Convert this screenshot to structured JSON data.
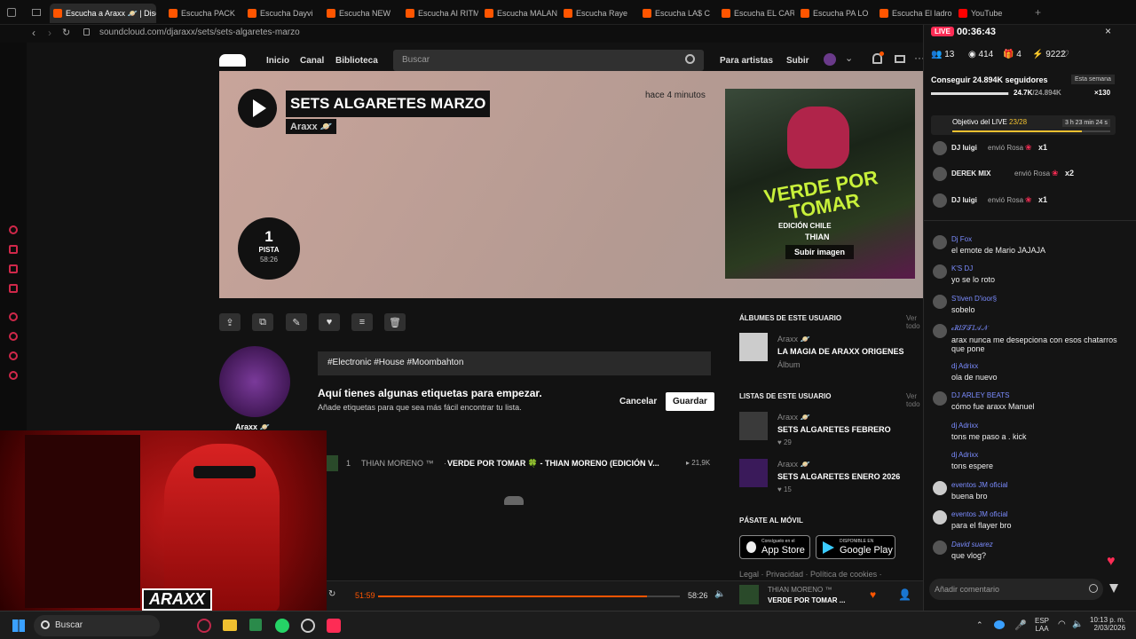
{
  "browser": {
    "tabs": [
      {
        "label": "Escucha a Araxx 🪐 | Disco"
      },
      {
        "label": "Escucha PACK"
      },
      {
        "label": "Escucha Dayvi"
      },
      {
        "label": "Escucha NEW"
      },
      {
        "label": "Escucha AI RITM"
      },
      {
        "label": "Escucha MALAN"
      },
      {
        "label": "Escucha Raye"
      },
      {
        "label": "Escucha LA$ C"
      },
      {
        "label": "Escucha EL CAR"
      },
      {
        "label": "Escucha PA LO"
      },
      {
        "label": "Escucha El ladro"
      },
      {
        "label": "YouTube"
      }
    ],
    "url": "soundcloud.com/djaraxx/sets/sets-algaretes-marzo"
  },
  "sc": {
    "nav": {
      "home": "Inicio",
      "feed": "Canal",
      "library": "Biblioteca",
      "search_placeholder": "Buscar",
      "artists": "Para artistas",
      "upload": "Subir"
    },
    "hero": {
      "title": "SETS ALGARETES MARZO",
      "artist": "Araxx 🪐",
      "posted": "hace 4 minutos",
      "tracks_count": "1",
      "tracks_label": "PISTA",
      "duration": "58:26",
      "upload_image": "Subir imagen",
      "cover_title": "VERDE POR TOMAR",
      "cover_sub": "EDICIÓN CHILE",
      "cover_artist": "THIAN"
    },
    "profile": {
      "name": "Araxx 🪐"
    },
    "tags": {
      "chips": "#Electronic  #House  #Moombahton",
      "heading": "Aquí tienes algunas etiquetas para empezar.",
      "subtitle": "Añade etiquetas para que sea más fácil encontrar tu lista.",
      "cancel": "Cancelar",
      "save": "Guardar"
    },
    "track": {
      "num": "1",
      "artist": "THIAN MORENO ™",
      "title": "VERDE POR TOMAR 🍀 - THIAN MORENO (EDICIÓN V...",
      "plays": "21,9K"
    },
    "sidebar": {
      "albums_heading": "ÁLBUMES DE ESTE USUARIO",
      "view_all": "Ver todo",
      "album": {
        "artist": "Araxx 🪐",
        "title": "LA MAGIA DE ARAXX ORIGENES",
        "type": "Álbum"
      },
      "lists_heading": "LISTAS DE ESTE USUARIO",
      "lists": [
        {
          "artist": "Araxx 🪐",
          "title": "SETS ALGARETES FEBRERO",
          "likes": "29"
        },
        {
          "artist": "Araxx 🪐",
          "title": "SETS ALGARETES ENERO 2026",
          "likes": "15"
        }
      ],
      "mobile_heading": "PÁSATE AL MÓVIL",
      "appstore_small": "Consíguelo en el",
      "appstore": "App Store",
      "play_small": "DISPONIBLE EN",
      "play": "Google Play",
      "footer": "Legal · Privacidad · Política de cookies ·"
    },
    "player": {
      "elapsed": "51:59",
      "total": "58:26",
      "progress": 0.89,
      "artist": "THIAN MORENO ™",
      "title": "VERDE POR TOMAR ..."
    }
  },
  "live": {
    "badge": "LIVE",
    "timer": "00:36:43",
    "stats": [
      "13",
      "414",
      "4",
      "9222"
    ],
    "goal_text": "Conseguir 24.894K seguidores",
    "goal_tag": "Esta semana",
    "goal_value": "24.7K",
    "goal_total": "/24.894K",
    "goal_progress": 0.99,
    "goal_multiplier": "×130",
    "objective": "Objetivo del LIVE",
    "objective_count": "23/28",
    "objective_time": "3 h 23 min 24 s",
    "gifts": [
      {
        "user": "DJ luigi",
        "text": "envió Rosa",
        "count": "x1"
      },
      {
        "user": "DEREK MIX",
        "text": "envió Rosa",
        "count": "x2"
      },
      {
        "user": "DJ luigi",
        "text": "envió Rosa",
        "count": "x1"
      }
    ],
    "chat": [
      {
        "user": "Dj Fox",
        "msg": "el emote de Mario JAJAJA"
      },
      {
        "user": "K'S DJ",
        "msg": "yo se lo roto"
      },
      {
        "user": "S'tiven D'ioor§",
        "msg": "sobelo"
      },
      {
        "user": "𝒸𝑅𝐼𝒮𝒯𝐼𝒜𝒩",
        "msg": "arax nunca me desepciona con esos chatarros que pone"
      },
      {
        "user": "dj Adrixx",
        "msg": "ola de nuevo"
      },
      {
        "user": "DJ ARLEY BEATS",
        "msg": "cómo fue araxx Manuel"
      },
      {
        "user": "dj Adrixx",
        "msg": "tons me paso a . kick"
      },
      {
        "user": "dj Adrixx",
        "msg": "tons espere"
      },
      {
        "user": "eventos JM oficial",
        "msg": "buena bro"
      },
      {
        "user": "eventos JM oficial",
        "msg": "para el flayer bro"
      },
      {
        "user": "David suarez",
        "msg": "que vlog?"
      }
    ],
    "comment_placeholder": "Añadir comentario"
  },
  "taskbar": {
    "search": "Buscar",
    "lang1": "ESP",
    "lang2": "LAA",
    "time": "10:13 p. m.",
    "date": "2/03/2026"
  },
  "cam": {
    "logo": "ARAXX"
  },
  "colors": {
    "accent": "#ff5500",
    "tiktok": "#fe2c55"
  }
}
